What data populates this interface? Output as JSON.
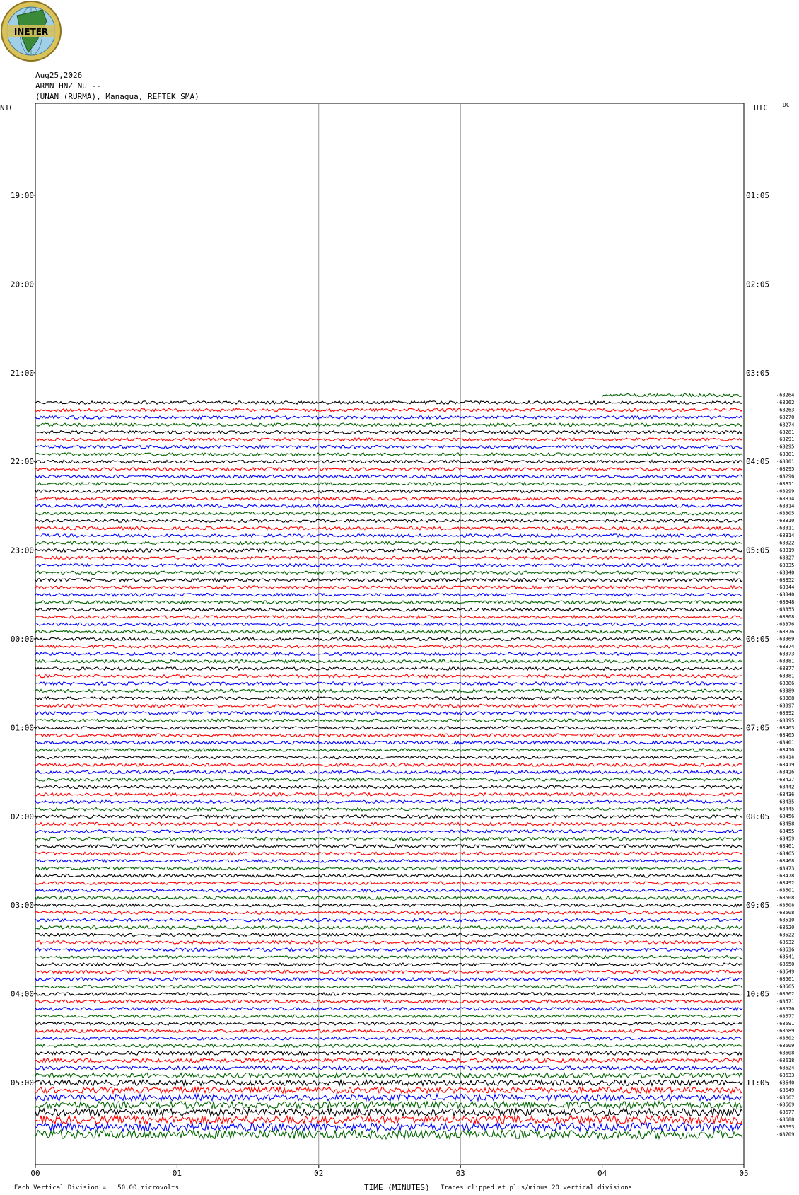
{
  "header": {
    "date": "Aug25,2026",
    "channel": "ARMN HNZ NU --",
    "station": "(UNAN (RURMA), Managua, REFTEK SMA)"
  },
  "logo": {
    "text": "INETER"
  },
  "left_axis_title": "NIC",
  "right_axis_title": "UTC",
  "right_corner": "DC",
  "footer": {
    "scale": "Each Vertical Division =   50.00 microvolts",
    "clip": "Traces clipped at plus/minus 20 vertical divisions"
  },
  "colors": {
    "black": "#000000",
    "red": "#ff0000",
    "blue": "#0000ff",
    "green": "#006400",
    "grid": "#808080"
  },
  "chart_data": {
    "type": "line",
    "xlabel": "TIME (MINUTES)",
    "x_ticks": [
      "00",
      "01",
      "02",
      "03",
      "04",
      "05"
    ],
    "xlim": [
      0,
      5
    ],
    "left_time_labels": [
      "19:00",
      "20:00",
      "21:00",
      "22:00",
      "23:00",
      "00:00",
      "01:00",
      "02:00",
      "03:00",
      "04:00",
      "05:00"
    ],
    "right_time_labels": [
      "01:05",
      "02:05",
      "03:05",
      "04:05",
      "05:05",
      "06:05",
      "07:05",
      "08:05",
      "09:05",
      "10:05",
      "11:05"
    ],
    "trace_colors_cycle": [
      "black",
      "red",
      "blue",
      "green"
    ],
    "first_partial_trace_start_minute": 4,
    "trace_offsets": [
      -68264,
      -68262,
      -68263,
      -68270,
      -68274,
      -68281,
      -68291,
      -68295,
      -68301,
      -68301,
      -68295,
      -68296,
      -68311,
      -68299,
      -68314,
      -68314,
      -68305,
      -68310,
      -68311,
      -68314,
      -68322,
      -68319,
      -68327,
      -68335,
      -68340,
      -68352,
      -68344,
      -68340,
      -68348,
      -68355,
      -68368,
      -68376,
      -68376,
      -68369,
      -68374,
      -68373,
      -68381,
      -68377,
      -68381,
      -68386,
      -68389,
      -68388,
      -68397,
      -68392,
      -68395,
      -68403,
      -68405,
      -68401,
      -68410,
      -68418,
      -68419,
      -68426,
      -68427,
      -68442,
      -68436,
      -68435,
      -68445,
      -68456,
      -68458,
      -68455,
      -68459,
      -68461,
      -68465,
      -68468,
      -68473,
      -68478,
      -68492,
      -68501,
      -68508,
      -68508,
      -68508,
      -68510,
      -68520,
      -68522,
      -68532,
      -68536,
      -68541,
      -68550,
      -68549,
      -68561,
      -68565,
      -68562,
      -68571,
      -68576,
      -68577,
      -68591,
      -68589,
      -68602,
      -68609,
      -68608,
      -68618,
      -68624,
      -68633,
      -68640,
      -68649,
      -68667,
      -68669,
      -68677,
      -68688,
      -68693,
      -68709
    ]
  }
}
